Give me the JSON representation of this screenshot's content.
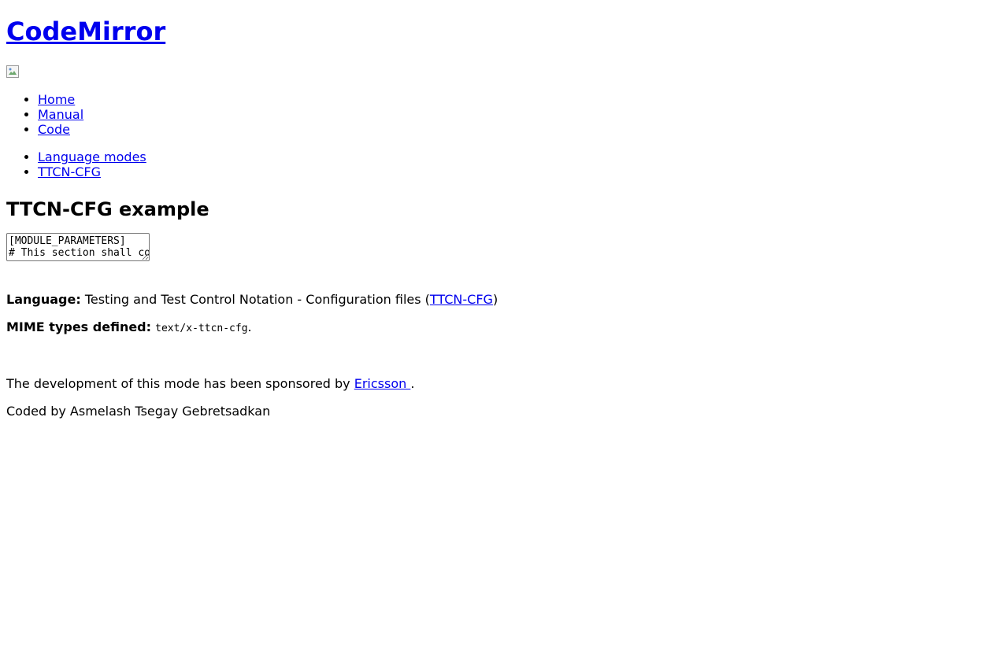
{
  "site": {
    "title": "CodeMirror"
  },
  "nav": {
    "main": [
      {
        "label": "Home"
      },
      {
        "label": "Manual"
      },
      {
        "label": "Code"
      }
    ],
    "sub": [
      {
        "label": "Language modes"
      },
      {
        "label": "TTCN-CFG"
      }
    ]
  },
  "main": {
    "heading": "TTCN-CFG example",
    "editor_value": "[MODULE_PARAMETERS]\n# This section shall contain the values of all parameters that are defined in your TTCN-3 modules.",
    "language_label": "Language:",
    "language_text_before": " Testing and Test Control Notation - Configuration files (",
    "language_link": "TTCN-CFG",
    "language_text_after": ")",
    "mime_label": "MIME types defined:",
    "mime_value": "text/x-ttcn-cfg",
    "mime_suffix": ".",
    "sponsor_text": "The development of this mode has been sponsored by ",
    "sponsor_link": "Ericsson ",
    "sponsor_suffix": ".",
    "credit": "Coded by Asmelash Tsegay Gebretsadkan"
  },
  "colors": {
    "link": "#0000ee",
    "text": "#000000",
    "background": "#ffffff"
  },
  "icons": {
    "logo": "broken-image-icon"
  }
}
